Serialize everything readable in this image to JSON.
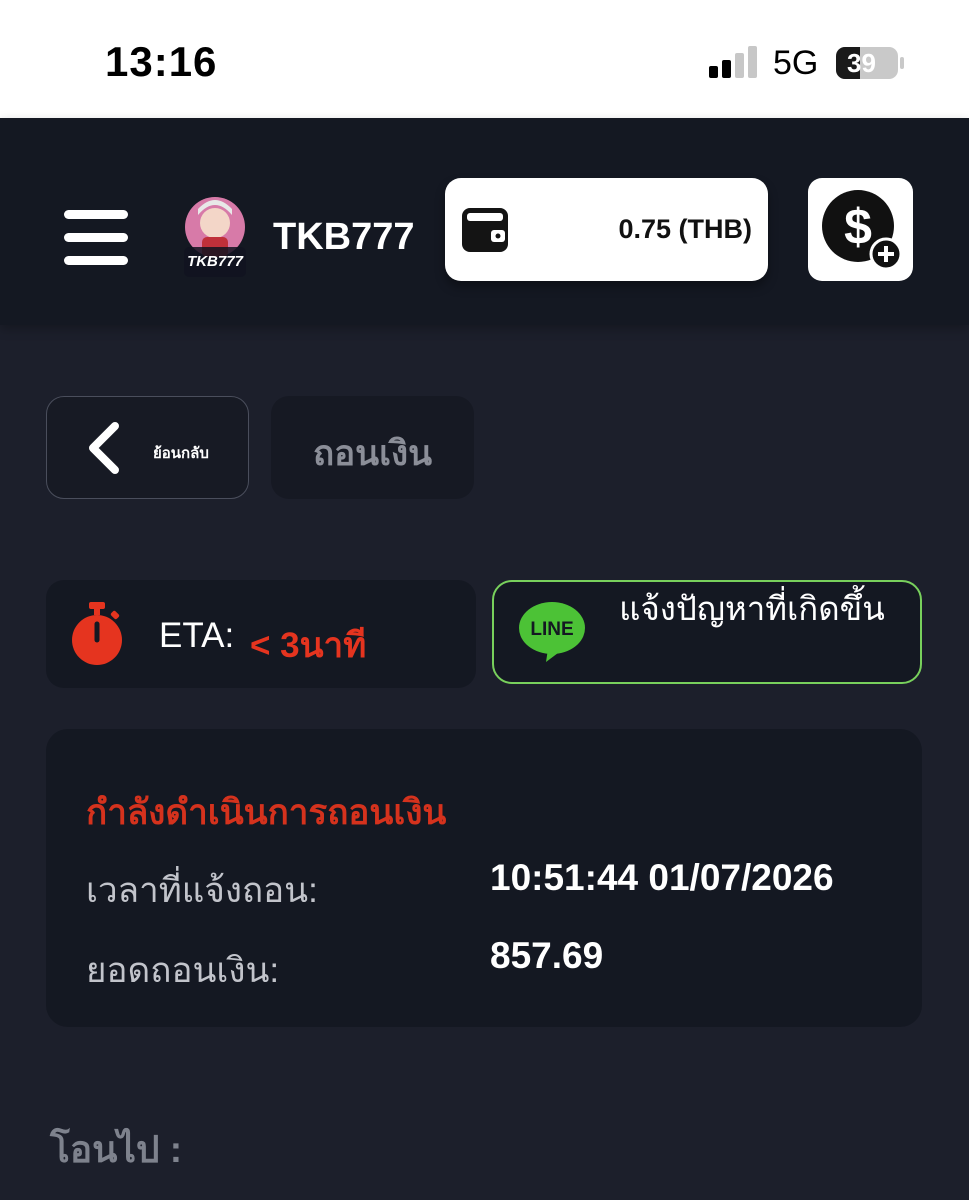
{
  "status_bar": {
    "time": "13:16",
    "network": "5G",
    "battery": "39"
  },
  "header": {
    "brand": "TKB777",
    "logo_text": "TKB777",
    "wallet_amount": "0.75 (THB)"
  },
  "nav": {
    "back_label": "ย้อนกลับ",
    "page_title": "ถอนเงิน"
  },
  "eta": {
    "label": "ETA:",
    "value": "< 3นาที"
  },
  "support": {
    "line_badge": "LINE",
    "label": "แจ้งปัญหาที่เกิดขึ้น"
  },
  "withdraw_status": {
    "title": "กำลังดำเนินการถอนเงิน",
    "request_time_label": "เวลาที่แจ้งถอน:",
    "request_time_value": "10:51:44 01/07/2026",
    "amount_label": "ยอดถอนเงิน:",
    "amount_value": "857.69"
  },
  "transfer": {
    "label": "โอนไป :"
  },
  "colors": {
    "background": "#1c1f2b",
    "panel": "#141822",
    "accent_red": "#e5341f",
    "line_green": "#78d05c"
  }
}
